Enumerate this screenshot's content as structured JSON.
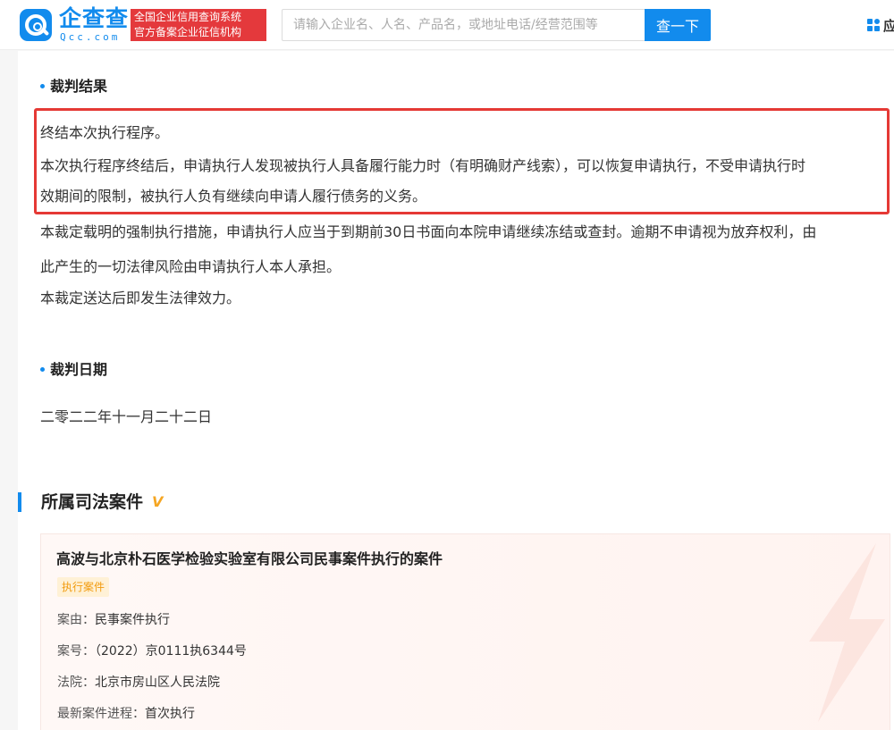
{
  "header": {
    "logo_name": "企查查",
    "logo_domain": "Qcc.com",
    "badge_line1": "全国企业信用查询系统",
    "badge_line2": "官方备案企业征信机构",
    "search_placeholder": "请输入企业名、人名、产品名，或地址电话/经营范围等",
    "search_button": "查一下",
    "apps_label": "应用"
  },
  "judgment_result": {
    "title": "裁判结果",
    "paragraphs": [
      "终结本次执行程序。",
      "本次执行程序终结后，申请执行人发现被执行人具备履行能力时（有明确财产线索），可以恢复申请执行，不受申请执行时",
      "效期间的限制，被执行人负有继续向申请人履行债务的义务。",
      "本裁定载明的强制执行措施，申请执行人应当于到期前30日书面向本院申请继续冻结或查封。逾期不申请视为放弃权利，由",
      "此产生的一切法律风险由申请执行人本人承担。",
      "本裁定送达后即发生法律效力。"
    ]
  },
  "judgment_date": {
    "title": "裁判日期",
    "value": "二零二二年十一月二十二日"
  },
  "related_cases": {
    "title": "所属司法案件",
    "vip_mark": "V",
    "case": {
      "title": "高波与北京朴石医学检验实验室有限公司民事案件执行的案件",
      "tag": "执行案件",
      "cause_label": "案由：",
      "cause_value": "民事案件执行",
      "number_label": "案号：",
      "number_value": "（2022）京0111执6344号",
      "court_label": "法院：",
      "court_value": "北京市房山区人民法院",
      "progress_label": "最新案件进程：",
      "progress_value": "首次执行"
    }
  },
  "colors": {
    "brand": "#128bed",
    "badge": "#e4393c",
    "highlight": "#e53935",
    "tag_text": "#f29b0e"
  }
}
